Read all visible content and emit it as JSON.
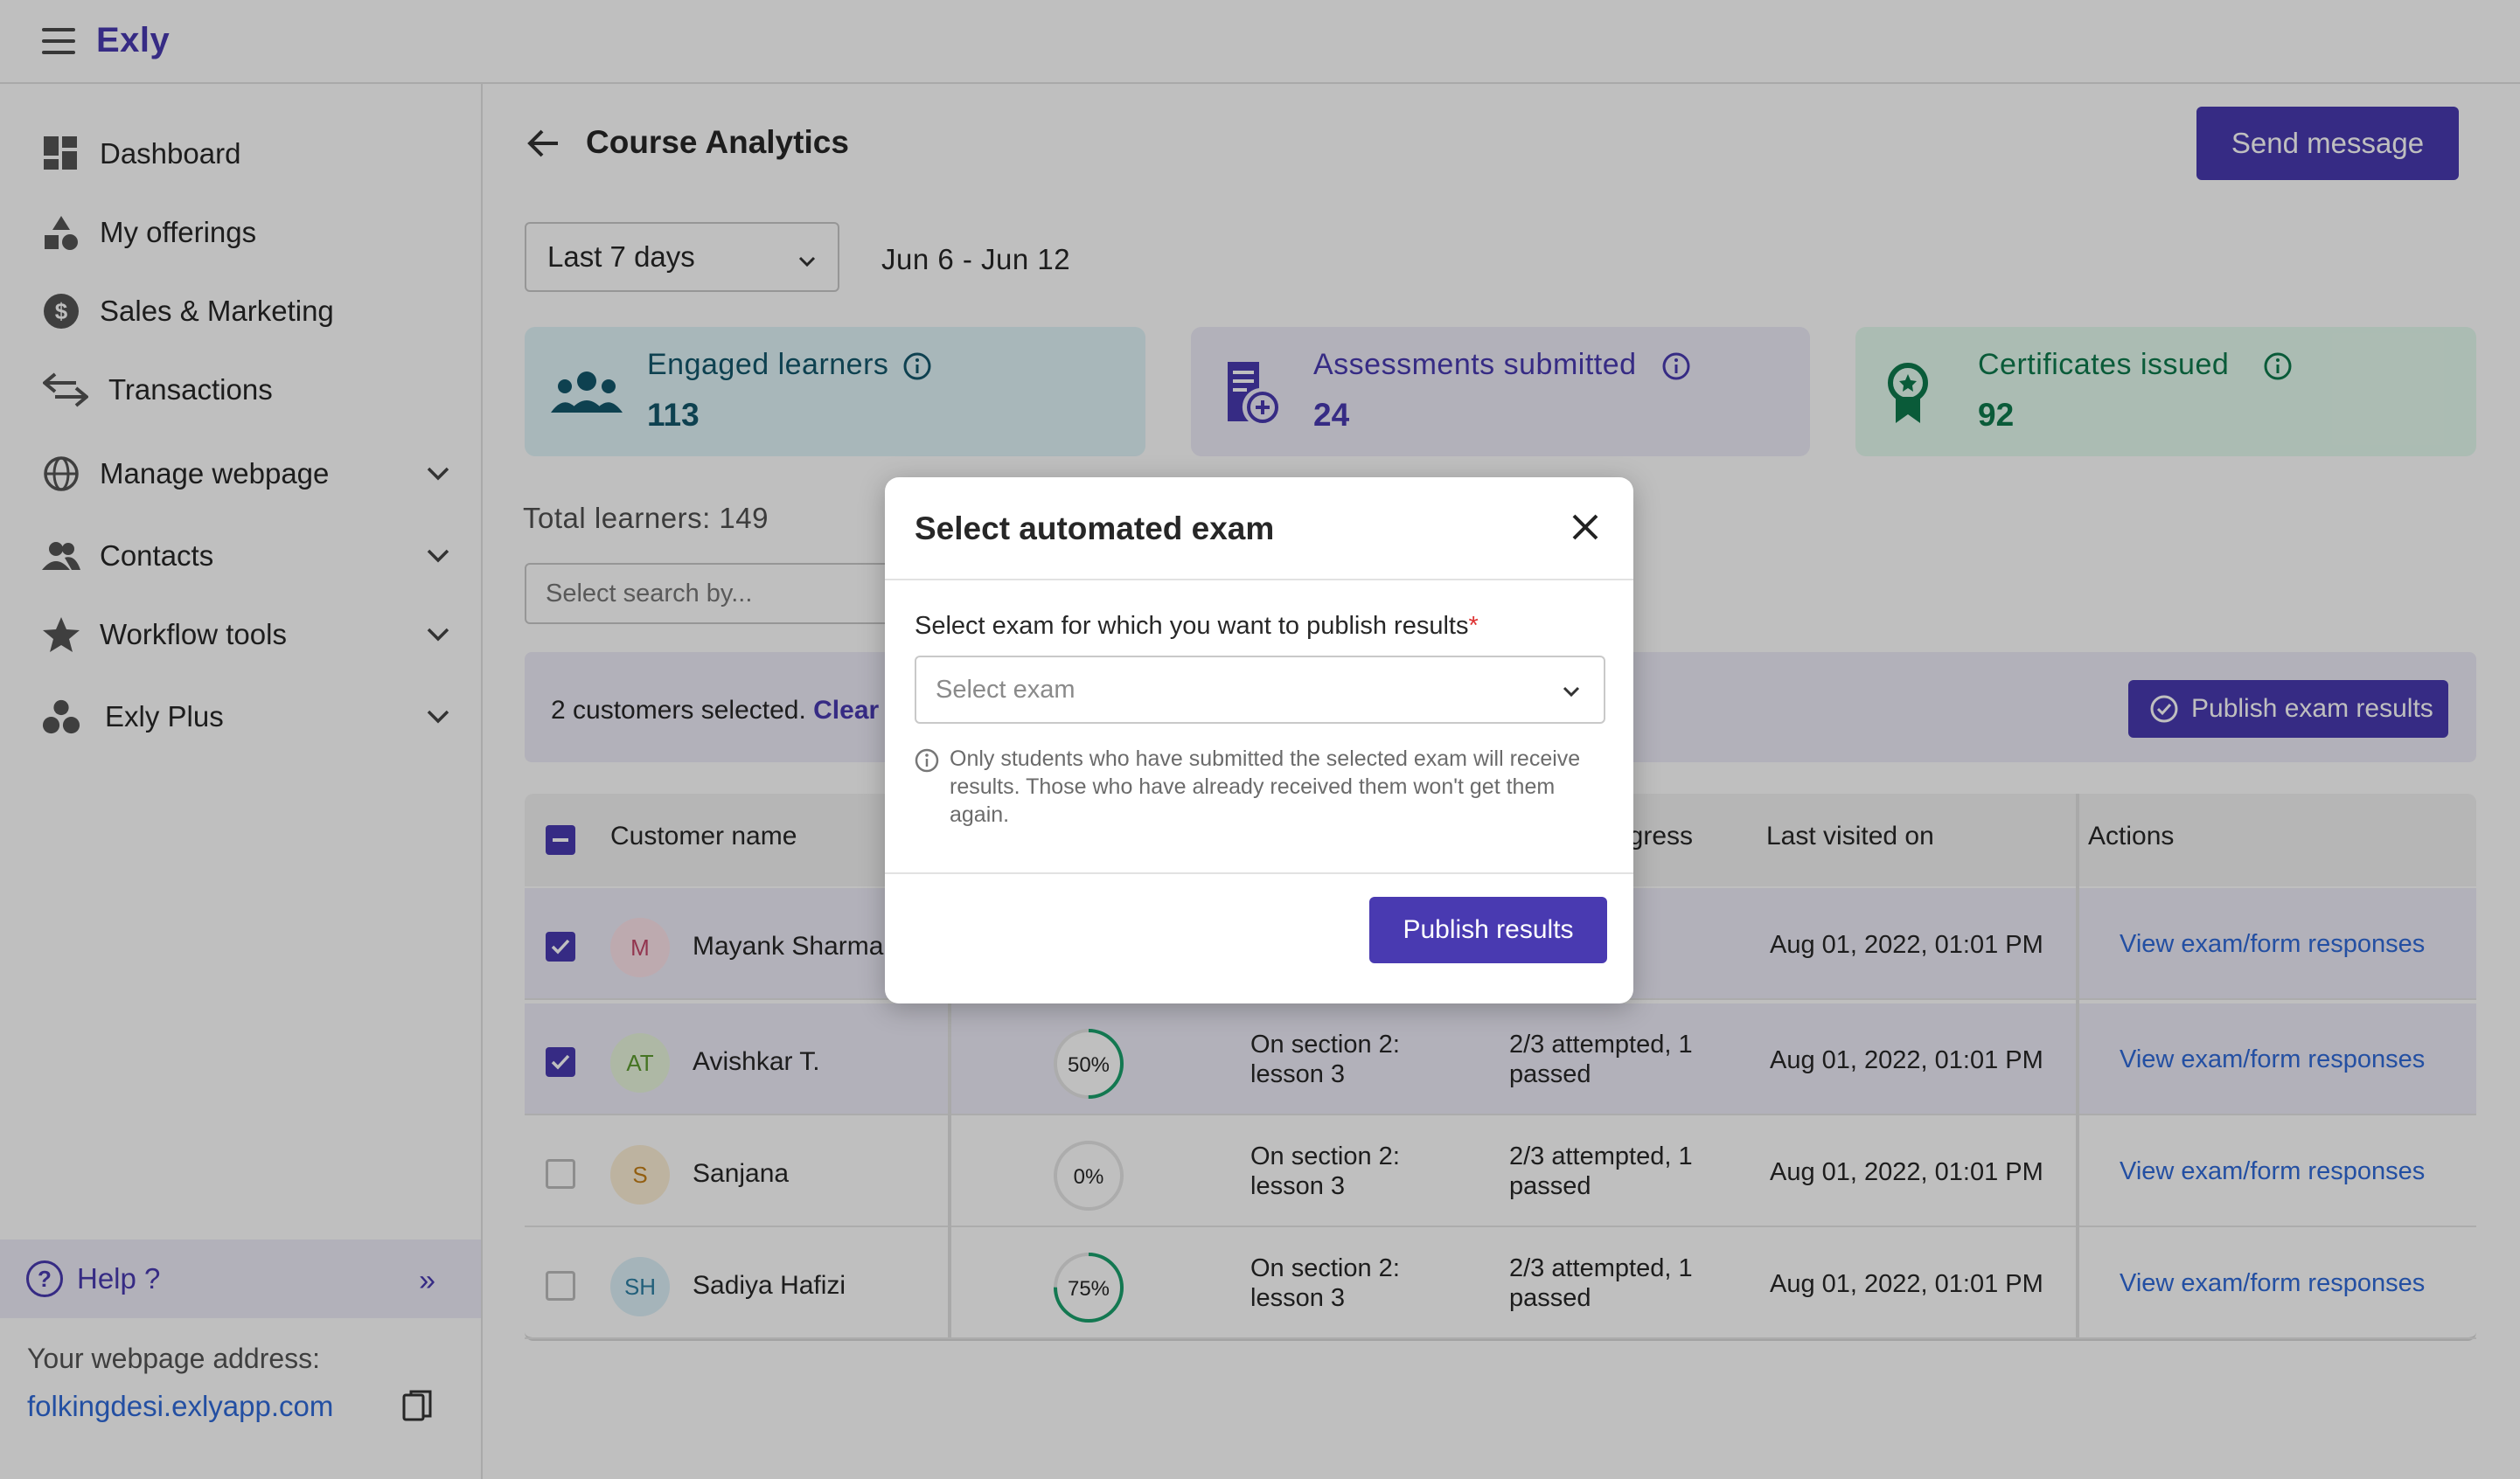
{
  "app": {
    "brand": "Exly"
  },
  "sidebar": {
    "items": [
      {
        "label": "Dashboard",
        "icon": "dashboard-icon"
      },
      {
        "label": "My offerings",
        "icon": "shapes-icon"
      },
      {
        "label": "Sales & Marketing",
        "icon": "dollar-icon"
      },
      {
        "label": "Transactions",
        "icon": "swap-arrows-icon"
      },
      {
        "label": "Manage webpage",
        "icon": "globe-icon",
        "expandable": true
      },
      {
        "label": "Contacts",
        "icon": "people-icon",
        "expandable": true
      },
      {
        "label": "Workflow tools",
        "icon": "star-icon",
        "expandable": true
      },
      {
        "label": "Exly Plus",
        "icon": "circles-icon",
        "expandable": true
      }
    ],
    "help_label": "Help ?",
    "webpage_label": "Your webpage address:",
    "webpage_url": "folkingdesi.exlyapp.com"
  },
  "header": {
    "title": "Course Analytics",
    "send_message_label": "Send message"
  },
  "filters": {
    "range_value": "Last 7 days",
    "date_range": "Jun 6 - Jun 12"
  },
  "stats": [
    {
      "label": "Engaged learners",
      "value": "113"
    },
    {
      "label": "Assessments submitted",
      "value": "24"
    },
    {
      "label": "Certificates issued",
      "value": "92"
    }
  ],
  "total_learners": "Total learners: 149",
  "search": {
    "placeholder": "Select search by..."
  },
  "selection": {
    "text": "2 customers selected.",
    "clear_label": "Clear s",
    "publish_label": "Publish exam results"
  },
  "table": {
    "columns": [
      "Customer name",
      "ogress",
      "Last visited on",
      "Actions"
    ],
    "rows": [
      {
        "initials": "M",
        "name": "Mayank Sharma",
        "checked": true,
        "progress": null,
        "progress_label": "",
        "section": "",
        "exam": "pted, 1",
        "last_visited": "Aug 01, 2022, 01:01 PM",
        "action": "View exam/form responses",
        "avatar_bg": "#fde3ea",
        "avatar_fg": "#c3476a"
      },
      {
        "initials": "AT",
        "name": "Avishkar T.",
        "checked": true,
        "progress": 0.5,
        "progress_label": "50%",
        "section": "On section 2: lesson 3",
        "exam": "2/3 attempted, 1 passed",
        "last_visited": "Aug 01, 2022, 01:01 PM",
        "action": "View exam/form responses",
        "avatar_bg": "#e8f6dc",
        "avatar_fg": "#5d9b2f"
      },
      {
        "initials": "S",
        "name": "Sanjana",
        "checked": false,
        "progress": 0,
        "progress_label": "0%",
        "section": "On section 2: lesson 3",
        "exam": "2/3 attempted, 1 passed",
        "last_visited": "Aug 01, 2022, 01:01 PM",
        "action": "View exam/form responses",
        "avatar_bg": "#fdefd6",
        "avatar_fg": "#c47f17"
      },
      {
        "initials": "SH",
        "name": "Sadiya Hafizi",
        "checked": false,
        "progress": 0.75,
        "progress_label": "75%",
        "section": "On section 2: lesson 3",
        "exam": "2/3 attempted, 1 passed",
        "last_visited": "Aug 01, 2022, 01:01 PM",
        "action": "View exam/form responses",
        "avatar_bg": "#dcf0f8",
        "avatar_fg": "#2d7fa3"
      }
    ]
  },
  "dialog": {
    "title": "Select automated exam",
    "field_label": "Select exam for which you want to publish results",
    "required_mark": "*",
    "select_placeholder": "Select exam",
    "hint": "Only students who have submitted the selected exam will receive results. Those who have already received them won't get them again.",
    "submit_label": "Publish results"
  },
  "colors": {
    "accent": "#493ab1",
    "progress": "#1aa06d",
    "link": "#2f6ad9"
  }
}
